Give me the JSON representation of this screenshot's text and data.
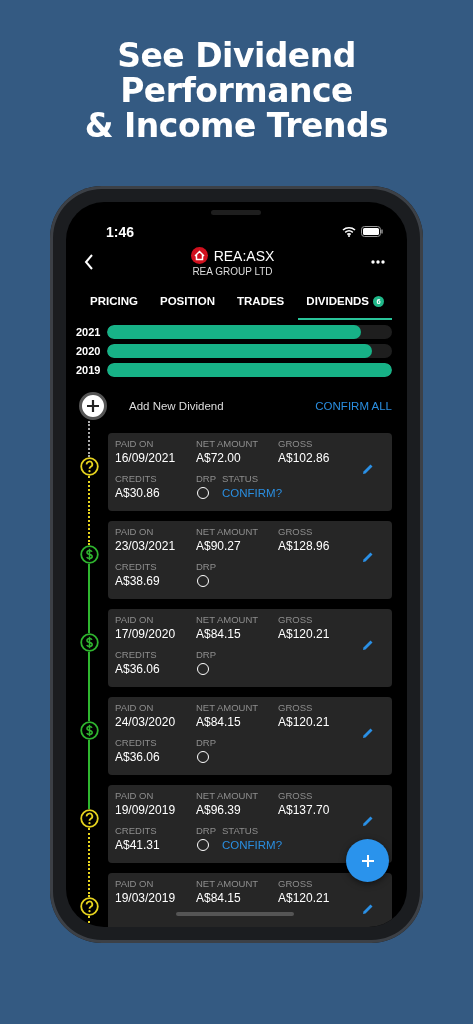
{
  "headline_lines": [
    "See Dividend",
    "Performance",
    "& Income Trends"
  ],
  "status_bar": {
    "time": "1:46"
  },
  "header": {
    "symbol": "REA:ASX",
    "company": "REA GROUP LTD"
  },
  "tabs": [
    {
      "label": "PRICING",
      "selected": false
    },
    {
      "label": "POSITION",
      "selected": false
    },
    {
      "label": "TRADES",
      "selected": false
    },
    {
      "label": "DIVIDENDS",
      "selected": true,
      "badge": "6"
    }
  ],
  "year_bars": [
    {
      "year": "2021",
      "level": 0.89
    },
    {
      "year": "2020",
      "level": 0.93
    },
    {
      "year": "2019",
      "level": 1.0
    }
  ],
  "add_label": "Add New Dividend",
  "confirm_all": "CONFIRM ALL",
  "dividends": [
    {
      "kind": "pending",
      "row_1": [
        {
          "label": "PAID ON",
          "value": "16/09/2021"
        },
        {
          "label": "NET AMOUNT",
          "value": "A$72.00"
        },
        {
          "label": "GROSS",
          "value": "A$102.86"
        }
      ],
      "row_2": [
        {
          "kind": "text",
          "label": "CREDITS",
          "value": "A$30.86"
        },
        {
          "kind": "radio",
          "label": "DRP",
          "checked": false
        },
        {
          "kind": "link",
          "label": "STATUS",
          "value": "CONFIRM?"
        }
      ]
    },
    {
      "kind": "paid",
      "row_1": [
        {
          "label": "PAID ON",
          "value": "23/03/2021"
        },
        {
          "label": "NET AMOUNT",
          "value": "A$90.27"
        },
        {
          "label": "GROSS",
          "value": "A$128.96"
        }
      ],
      "row_2": [
        {
          "kind": "text",
          "label": "CREDITS",
          "value": "A$38.69"
        },
        {
          "kind": "radio",
          "label": "DRP",
          "checked": false
        }
      ]
    },
    {
      "kind": "paid",
      "row_1": [
        {
          "label": "PAID ON",
          "value": "17/09/2020"
        },
        {
          "label": "NET AMOUNT",
          "value": "A$84.15"
        },
        {
          "label": "GROSS",
          "value": "A$120.21"
        }
      ],
      "row_2": [
        {
          "kind": "text",
          "label": "CREDITS",
          "value": "A$36.06"
        },
        {
          "kind": "radio",
          "label": "DRP",
          "checked": false
        }
      ]
    },
    {
      "kind": "paid",
      "row_1": [
        {
          "label": "PAID ON",
          "value": "24/03/2020"
        },
        {
          "label": "NET AMOUNT",
          "value": "A$84.15"
        },
        {
          "label": "GROSS",
          "value": "A$120.21"
        }
      ],
      "row_2": [
        {
          "kind": "text",
          "label": "CREDITS",
          "value": "A$36.06"
        },
        {
          "kind": "radio",
          "label": "DRP",
          "checked": false
        }
      ]
    },
    {
      "kind": "pending",
      "row_1": [
        {
          "label": "PAID ON",
          "value": "19/09/2019"
        },
        {
          "label": "NET AMOUNT",
          "value": "A$96.39"
        },
        {
          "label": "GROSS",
          "value": "A$137.70"
        }
      ],
      "row_2": [
        {
          "kind": "text",
          "label": "CREDITS",
          "value": "A$41.31"
        },
        {
          "kind": "radio",
          "label": "DRP",
          "checked": false
        },
        {
          "kind": "link",
          "label": "STATUS",
          "value": "CONFIRM?"
        }
      ]
    },
    {
      "kind": "pending",
      "row_1": [
        {
          "label": "PAID ON",
          "value": "19/03/2019"
        },
        {
          "label": "NET AMOUNT",
          "value": "A$84.15"
        },
        {
          "label": "GROSS",
          "value": "A$120.21"
        }
      ]
    }
  ]
}
